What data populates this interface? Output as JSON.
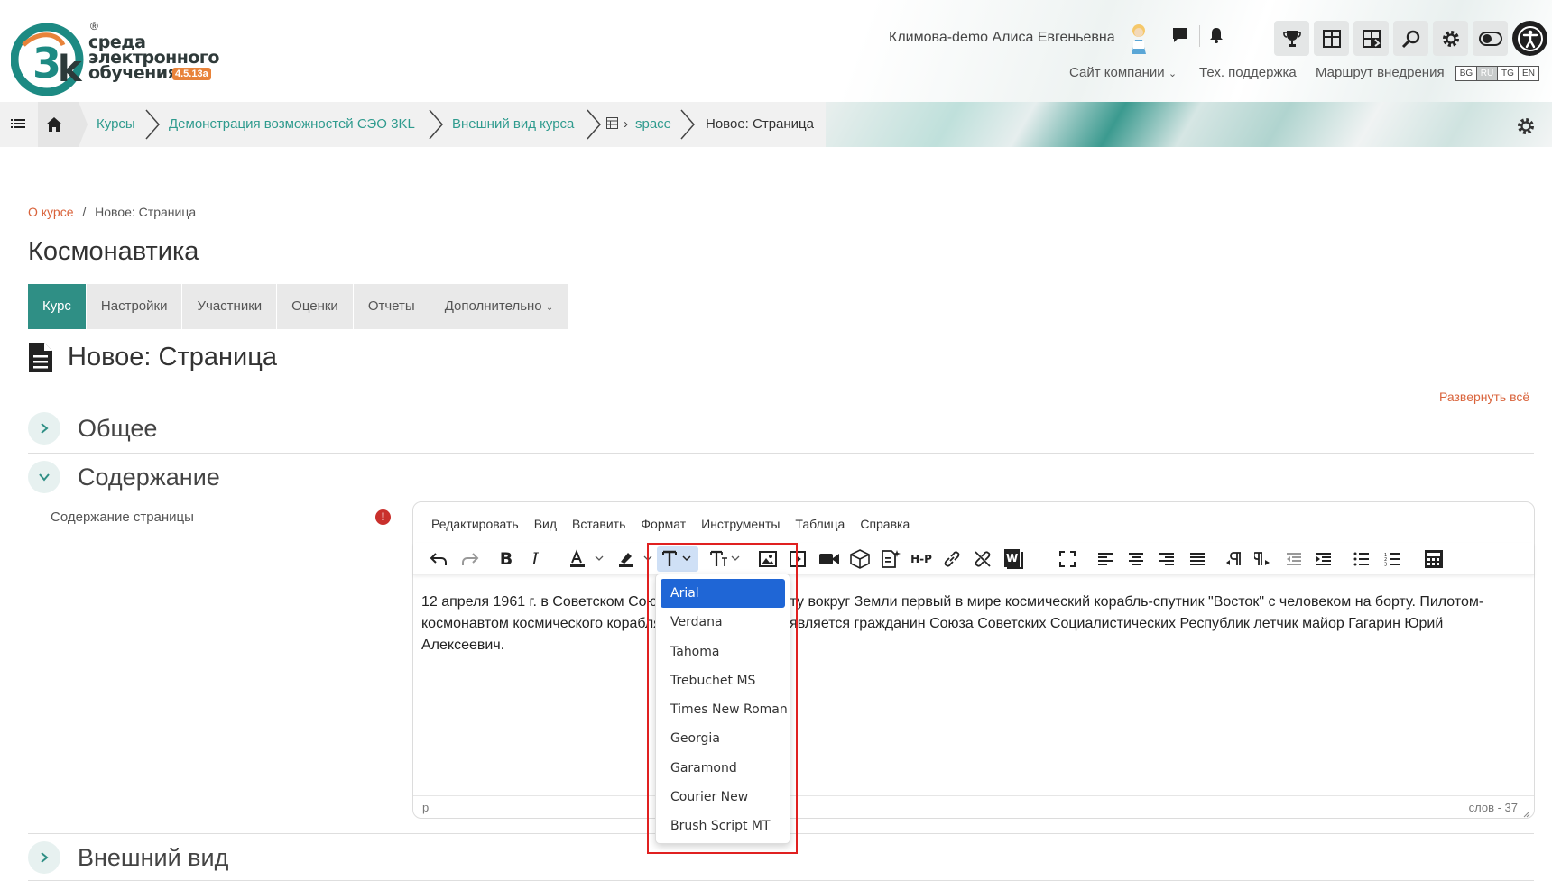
{
  "header": {
    "logo": {
      "mark_text": "3k",
      "registered": "®",
      "line1": "среда",
      "line2": "электронного",
      "line3": "обучения",
      "version": "4.5.13а"
    },
    "user_name": "Климова-demo Алиса Евгеньевна",
    "top_links": [
      "Сайт компании",
      "Тех. поддержка",
      "Маршрут внедрения"
    ],
    "languages": [
      "BG",
      "RU",
      "TG",
      "EN"
    ],
    "active_language": "RU",
    "icons": [
      "chat-icon",
      "bell-icon",
      "trophy-icon",
      "dashboard-icon",
      "grid-icon",
      "search-icon",
      "settings-icon",
      "toggle-icon",
      "accessibility-icon"
    ]
  },
  "navbar": {
    "crumbs": [
      "Курсы",
      "Демонстрация возможностей СЭО 3KL",
      "Внешний вид курса",
      "space"
    ],
    "current": "Новое: Страница"
  },
  "page": {
    "breadcrumb_link": "О курсе",
    "breadcrumb_sep": "/",
    "breadcrumb_current": "Новое: Страница",
    "course_title": "Космонавтика",
    "tabs": [
      "Курс",
      "Настройки",
      "Участники",
      "Оценки",
      "Отчеты",
      "Дополнительно"
    ],
    "active_tab": "Курс",
    "heading": "Новое: Страница",
    "expand_all": "Развернуть всё",
    "sections": {
      "general": "Общее",
      "content": "Содержание",
      "appearance": "Внешний вид"
    },
    "content_label": "Содержание страницы",
    "required_icon": "!"
  },
  "editor": {
    "menu": [
      "Редактировать",
      "Вид",
      "Вставить",
      "Формат",
      "Инструменты",
      "Таблица",
      "Справка"
    ],
    "body_text": "12 апреля 1961 г. в Советском Союзе выведен на орбиту вокруг Земли первый в мире космический корабль-спутник \"Восток\" с человеком на борту. Пилотом-космонавтом космического корабля-спутника \"Восток\" является гражданин Союза Советских Социалистических Республик летчик майор Гагарин Юрий Алексеевич.",
    "status_path": "p",
    "word_count": "слов - 37",
    "h5p_label": "H-P"
  },
  "font_dropdown": {
    "options": [
      "Arial",
      "Verdana",
      "Tahoma",
      "Trebuchet MS",
      "Times New Roman",
      "Georgia",
      "Garamond",
      "Courier New",
      "Brush Script MT"
    ],
    "selected": "Arial"
  },
  "colors": {
    "accent": "#2f8f85",
    "link_orange": "#d9633b",
    "selected_option": "#1f66d6",
    "highlight": "#e02020"
  }
}
